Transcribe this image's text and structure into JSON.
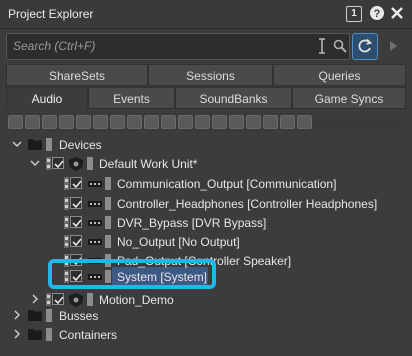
{
  "window": {
    "title": "Project Explorer",
    "badge": "1"
  },
  "search": {
    "placeholder": "Search (Ctrl+F)"
  },
  "tabs_row1": [
    "ShareSets",
    "Sessions",
    "Queries"
  ],
  "tabs_row2": [
    "Audio",
    "Events",
    "SoundBanks",
    "Game Syncs"
  ],
  "active_tab": "Audio",
  "colors": {
    "selection": "#3d5a85",
    "highlight": "#1fb8e8",
    "sync_button": "#2e4e70"
  },
  "tree": {
    "devices": "Devices",
    "work_unit": "Default Work Unit*",
    "items": [
      "Communication_Output [Communication]",
      "Controller_Headphones [Controller Headphones]",
      "DVR_Bypass [DVR Bypass]",
      "No_Output [No Output]",
      "Pad_Output [Controller Speaker]",
      "System [System]"
    ],
    "motion": "Motion_Demo",
    "busses": "Busses",
    "containers": "Containers"
  }
}
